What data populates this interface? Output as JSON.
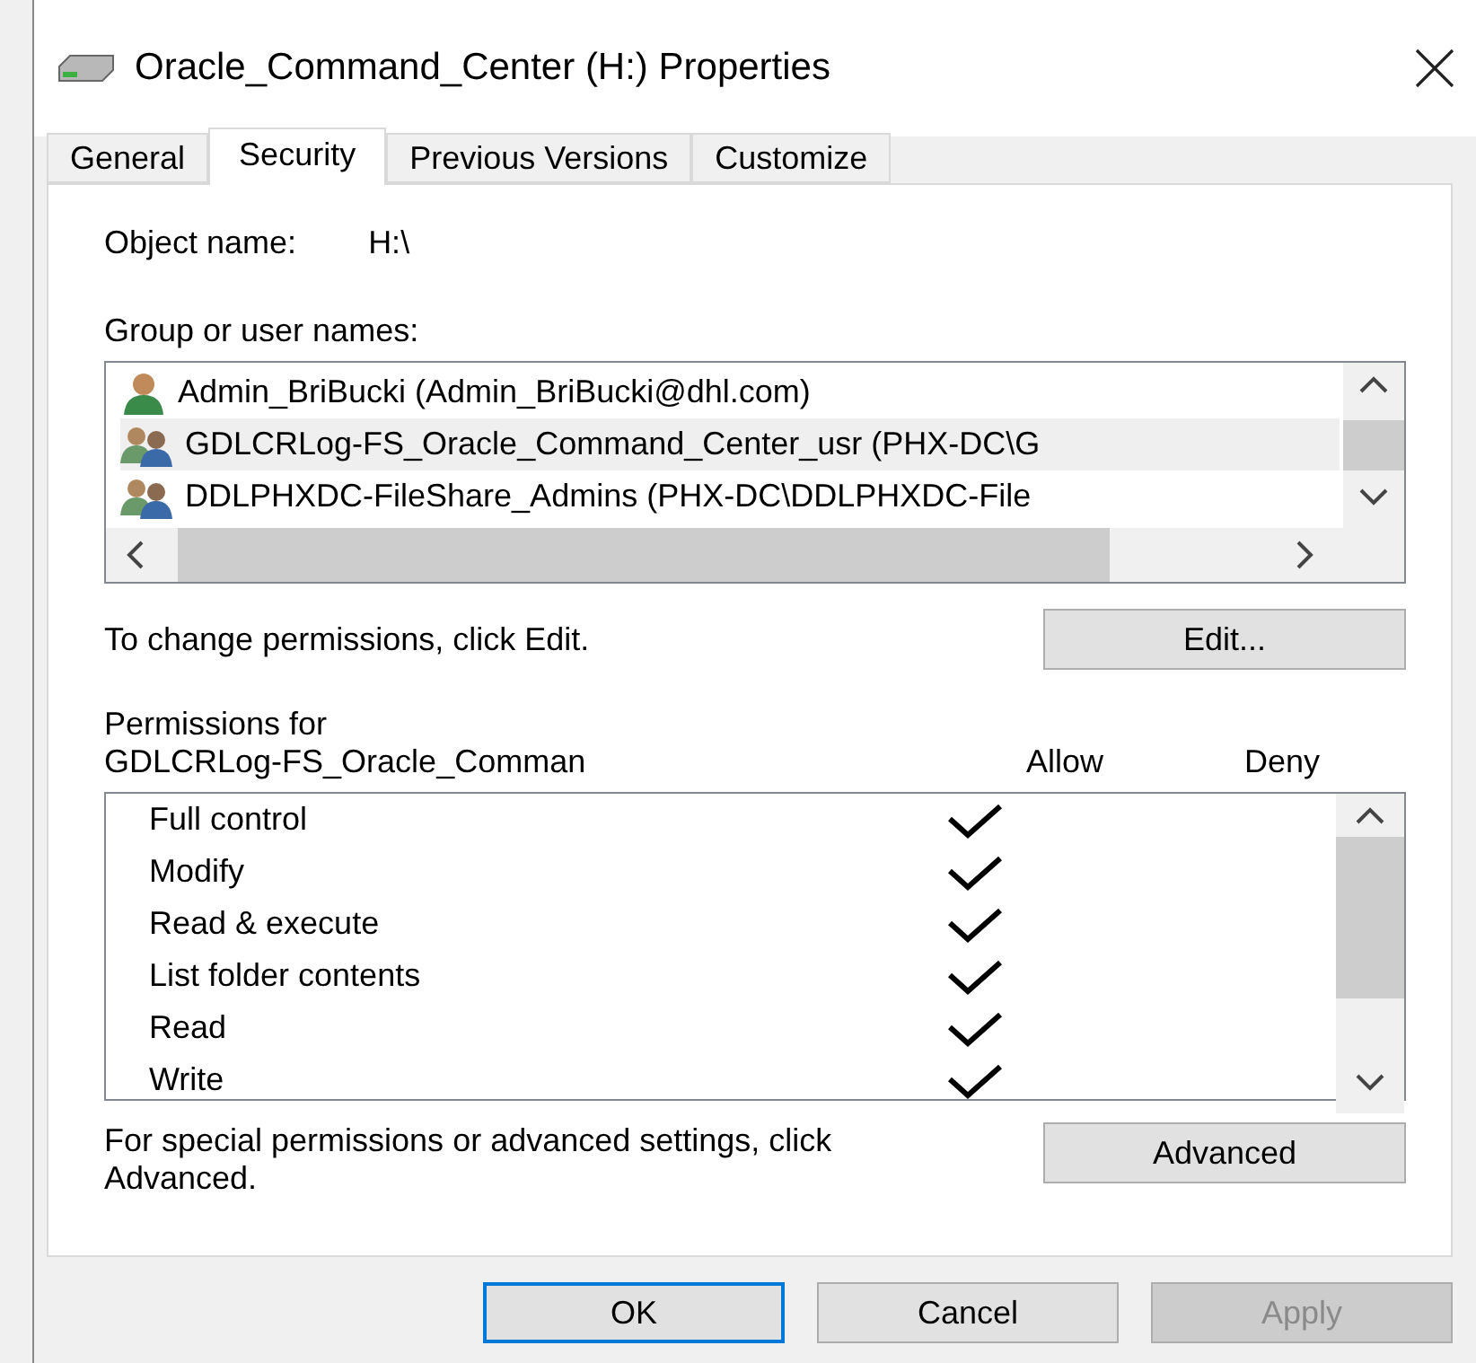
{
  "window": {
    "title": "Oracle_Command_Center (H:) Properties"
  },
  "tabs": [
    {
      "label": "General",
      "selected": false
    },
    {
      "label": "Security",
      "selected": true
    },
    {
      "label": "Previous Versions",
      "selected": false
    },
    {
      "label": "Customize",
      "selected": false
    }
  ],
  "object_name": {
    "label": "Object name:",
    "value": "H:\\"
  },
  "group_list": {
    "label": "Group or user names:",
    "items": [
      {
        "name": "Admin_BriBucki (Admin_BriBucki@dhl.com)",
        "kind": "user",
        "selected": false
      },
      {
        "name": "GDLCRLog-FS_Oracle_Command_Center_usr (PHX-DC\\G",
        "kind": "group",
        "selected": true
      },
      {
        "name": "DDLPHXDC-FileShare_Admins (PHX-DC\\DDLPHXDC-File",
        "kind": "group",
        "selected": false
      }
    ]
  },
  "edit_hint": "To change permissions, click Edit.",
  "edit_button": "Edit...",
  "permissions": {
    "label": "Permissions for",
    "principal": "GDLCRLog-FS_Oracle_Comman",
    "allow_header": "Allow",
    "deny_header": "Deny",
    "rows": [
      {
        "name": "Full control",
        "allow": true,
        "deny": false
      },
      {
        "name": "Modify",
        "allow": true,
        "deny": false
      },
      {
        "name": "Read & execute",
        "allow": true,
        "deny": false
      },
      {
        "name": "List folder contents",
        "allow": true,
        "deny": false
      },
      {
        "name": "Read",
        "allow": true,
        "deny": false
      },
      {
        "name": "Write",
        "allow": true,
        "deny": false
      }
    ]
  },
  "advanced_hint": "For special permissions or advanced settings, click Advanced.",
  "advanced_button": "Advanced",
  "buttons": [
    {
      "label": "OK",
      "default": true,
      "disabled": false
    },
    {
      "label": "Cancel",
      "default": false,
      "disabled": false
    },
    {
      "label": "Apply",
      "default": false,
      "disabled": true
    }
  ]
}
